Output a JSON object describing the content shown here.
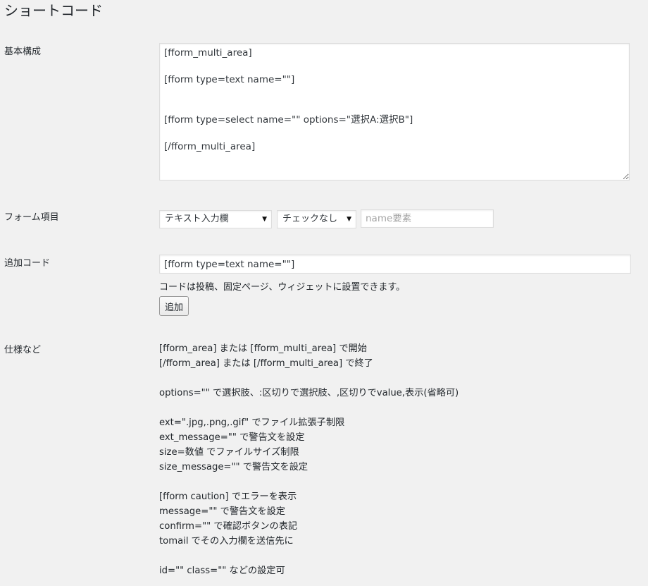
{
  "page": {
    "title": "ショートコード"
  },
  "basic": {
    "label": "基本構成",
    "content": "[fform_multi_area]\n\n[fform type=text name=\"\"]\n\n\n[fform type=select name=\"\" options=\"選択A:選択B\"]\n\n[/fform_multi_area]"
  },
  "form_items": {
    "label": "フォーム項目",
    "type_select": "テキスト入力欄",
    "check_select": "チェックなし",
    "name_placeholder": "name要素"
  },
  "add_code": {
    "label": "追加コード",
    "value": "[fform type=text name=\"\"]",
    "note": "コードは投稿、固定ページ、ウィジェットに設置できます。",
    "button_label": "追加"
  },
  "spec": {
    "label": "仕様など",
    "lines": [
      "[fform_area] または [fform_multi_area] で開始",
      "[/fform_area] または [/fform_multi_area] で終了",
      "",
      "options=\"\" で選択肢、:区切りで選択肢、,区切りでvalue,表示(省略可)",
      "",
      "ext=\".jpg,.png,.gif\" でファイル拡張子制限",
      "ext_message=\"\" で警告文を設定",
      "size=数値 でファイルサイズ制限",
      "size_message=\"\" で警告文を設定",
      "",
      "[fform caution] でエラーを表示",
      "message=\"\" で警告文を設定",
      "confirm=\"\" で確認ボタンの表記",
      "tomail でその入力欄を送信先に",
      "",
      "id=\"\" class=\"\" などの設定可"
    ]
  }
}
